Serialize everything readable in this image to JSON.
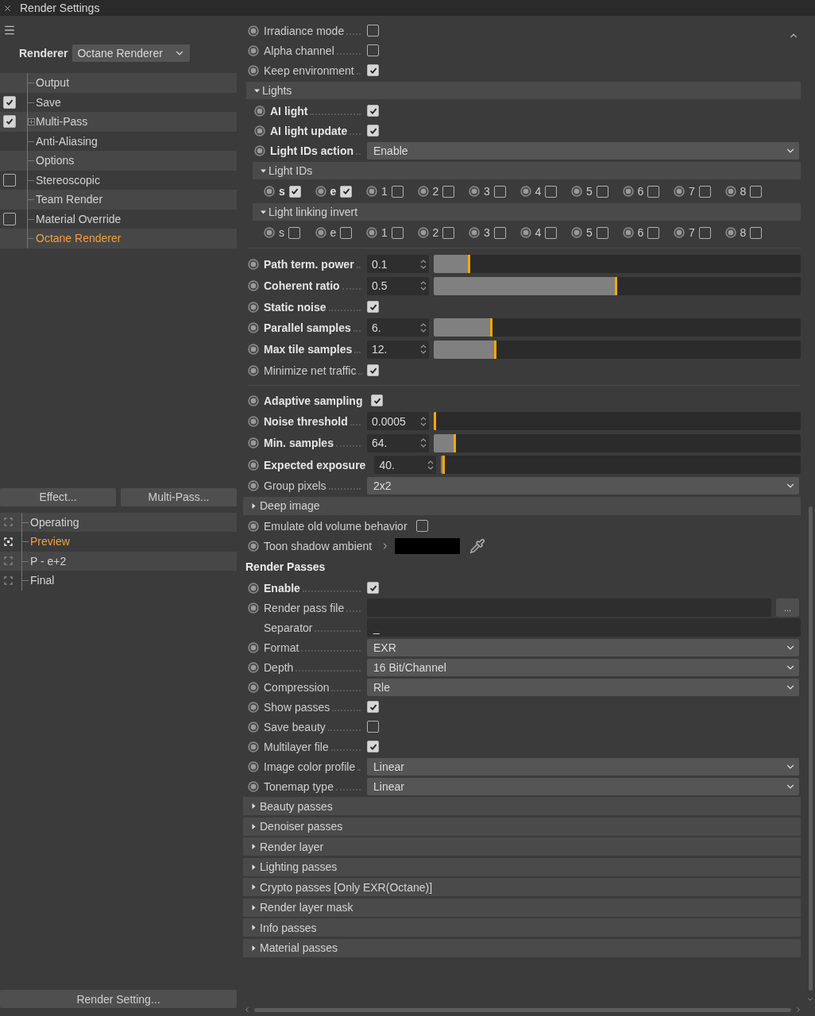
{
  "window": {
    "title": "Render Settings"
  },
  "sidebar": {
    "renderer": {
      "label": "Renderer",
      "value": "Octane Renderer"
    },
    "items": [
      {
        "label": "Output",
        "kind": "plain",
        "selected": false
      },
      {
        "label": "Save",
        "kind": "toggle",
        "checked": true,
        "selected": false
      },
      {
        "label": "Multi-Pass",
        "kind": "toggle",
        "checked": true,
        "expanded": false,
        "selected": false
      },
      {
        "label": "Anti-Aliasing",
        "kind": "plain",
        "selected": false
      },
      {
        "label": "Options",
        "kind": "plain",
        "selected": false
      },
      {
        "label": "Stereoscopic",
        "kind": "toggle",
        "checked": false,
        "selected": false
      },
      {
        "label": "Team Render",
        "kind": "plain",
        "selected": false
      },
      {
        "label": "Material Override",
        "kind": "toggle",
        "checked": false,
        "selected": false
      },
      {
        "label": "Octane Renderer",
        "kind": "plain",
        "selected": true
      }
    ],
    "buttons": [
      "Effect...",
      "Multi-Pass..."
    ],
    "presets": [
      {
        "label": "Operating",
        "selected": false
      },
      {
        "label": "Preview",
        "selected": true
      },
      {
        "label": "P - e+2",
        "selected": false
      },
      {
        "label": "Final",
        "selected": false
      }
    ],
    "footer_button": "Render Setting..."
  },
  "settings": {
    "rows": [
      {
        "kind": "checkbox",
        "label": "Irradiance mode",
        "checked": false
      },
      {
        "kind": "checkbox",
        "label": "Alpha channel",
        "checked": false
      },
      {
        "kind": "checkbox",
        "label": "Keep environment",
        "checked": true
      },
      {
        "kind": "section",
        "label": "Lights",
        "expanded": true,
        "children": [
          {
            "kind": "checkbox",
            "label": "AI light",
            "checked": true,
            "bold": true
          },
          {
            "kind": "checkbox",
            "label": "AI light update",
            "checked": true,
            "bold": true
          },
          {
            "kind": "dropdown",
            "label": "Light IDs action",
            "value": "Enable",
            "bold": true
          },
          {
            "kind": "section",
            "label": "Light IDs",
            "expanded": true,
            "children": [
              {
                "kind": "ids",
                "items": [
                  {
                    "label": "s",
                    "checked": true
                  },
                  {
                    "label": "e",
                    "checked": true
                  },
                  {
                    "label": "1",
                    "checked": false
                  },
                  {
                    "label": "2",
                    "checked": false
                  },
                  {
                    "label": "3",
                    "checked": false
                  },
                  {
                    "label": "4",
                    "checked": false
                  },
                  {
                    "label": "5",
                    "checked": false
                  },
                  {
                    "label": "6",
                    "checked": false
                  },
                  {
                    "label": "7",
                    "checked": false
                  },
                  {
                    "label": "8",
                    "checked": false
                  }
                ]
              }
            ]
          },
          {
            "kind": "section",
            "label": "Light linking invert",
            "expanded": true,
            "children": [
              {
                "kind": "ids",
                "items": [
                  {
                    "label": "s",
                    "checked": false
                  },
                  {
                    "label": "e",
                    "checked": false
                  },
                  {
                    "label": "1",
                    "checked": false
                  },
                  {
                    "label": "2",
                    "checked": false
                  },
                  {
                    "label": "3",
                    "checked": false
                  },
                  {
                    "label": "4",
                    "checked": false
                  },
                  {
                    "label": "5",
                    "checked": false
                  },
                  {
                    "label": "6",
                    "checked": false
                  },
                  {
                    "label": "7",
                    "checked": false
                  },
                  {
                    "label": "8",
                    "checked": false
                  }
                ]
              }
            ]
          }
        ]
      },
      {
        "kind": "divider"
      },
      {
        "kind": "slider",
        "label": "Path term. power",
        "value": "0.1",
        "level": 0.1,
        "bold": true
      },
      {
        "kind": "slider",
        "label": "Coherent ratio",
        "value": "0.5",
        "level": 0.5,
        "bold": true
      },
      {
        "kind": "checkbox",
        "label": "Static noise",
        "checked": true,
        "bold": true
      },
      {
        "kind": "slider",
        "label": "Parallel samples",
        "value": "6.",
        "level": 0.16,
        "bold": true
      },
      {
        "kind": "slider",
        "label": "Max tile samples",
        "value": "12.",
        "level": 0.17,
        "bold": true
      },
      {
        "kind": "checkbox",
        "label": "Minimize net traffic",
        "checked": true
      },
      {
        "kind": "divider"
      },
      {
        "kind": "checkbox",
        "label": "Adaptive sampling",
        "checked": true,
        "bold": true
      },
      {
        "kind": "slider",
        "label": "Noise threshold",
        "value": "0.0005",
        "level": 0.0,
        "bold": true
      },
      {
        "kind": "slider",
        "label": "Min. samples",
        "value": "64.",
        "level": 0.06,
        "bold": true
      },
      {
        "kind": "slider",
        "label": "Expected exposure",
        "value": "40.",
        "level": 0.01,
        "bold": true
      },
      {
        "kind": "dropdown",
        "label": "Group pixels",
        "value": "2x2"
      },
      {
        "kind": "group",
        "label": "Deep image",
        "expanded": false
      },
      {
        "kind": "checkbox",
        "label": "Emulate old volume behavior",
        "checked": false
      },
      {
        "kind": "color",
        "label": "Toon shadow ambient",
        "color": "#000000"
      },
      {
        "kind": "heading",
        "label": "Render Passes"
      },
      {
        "kind": "checkbox",
        "label": "Enable",
        "checked": true,
        "bold": true
      },
      {
        "kind": "file",
        "label": "Render pass file",
        "button": "..."
      },
      {
        "kind": "text",
        "label": "Separator",
        "value": "_"
      },
      {
        "kind": "dropdown",
        "label": "Format",
        "value": "EXR"
      },
      {
        "kind": "dropdown",
        "label": "Depth",
        "value": "16 Bit/Channel"
      },
      {
        "kind": "dropdown",
        "label": "Compression",
        "value": "Rle"
      },
      {
        "kind": "checkbox",
        "label": "Show passes",
        "checked": true
      },
      {
        "kind": "checkbox",
        "label": "Save beauty",
        "checked": false
      },
      {
        "kind": "checkbox",
        "label": "Multilayer file",
        "checked": true
      },
      {
        "kind": "dropdown",
        "label": "Image color profile",
        "value": "Linear"
      },
      {
        "kind": "dropdown",
        "label": "Tonemap type",
        "value": "Linear"
      },
      {
        "kind": "group",
        "label": "Beauty passes",
        "expanded": false
      },
      {
        "kind": "group",
        "label": "Denoiser passes",
        "expanded": false
      },
      {
        "kind": "group",
        "label": "Render layer",
        "expanded": false
      },
      {
        "kind": "group",
        "label": "Lighting passes",
        "expanded": false
      },
      {
        "kind": "group",
        "label": "Crypto passes [Only EXR(Octane)]",
        "expanded": false
      },
      {
        "kind": "group",
        "label": "Render layer mask",
        "expanded": false
      },
      {
        "kind": "group",
        "label": "Info passes",
        "expanded": false
      },
      {
        "kind": "group",
        "label": "Material passes",
        "expanded": false
      }
    ]
  }
}
